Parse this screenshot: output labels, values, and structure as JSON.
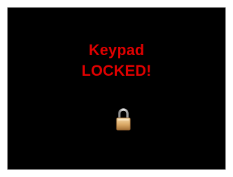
{
  "keypad_status": {
    "line1": "Keypad",
    "line2": "LOCKED!",
    "text_color": "#e00000",
    "background_color": "#000000",
    "icon": "padlock-locked-icon"
  }
}
